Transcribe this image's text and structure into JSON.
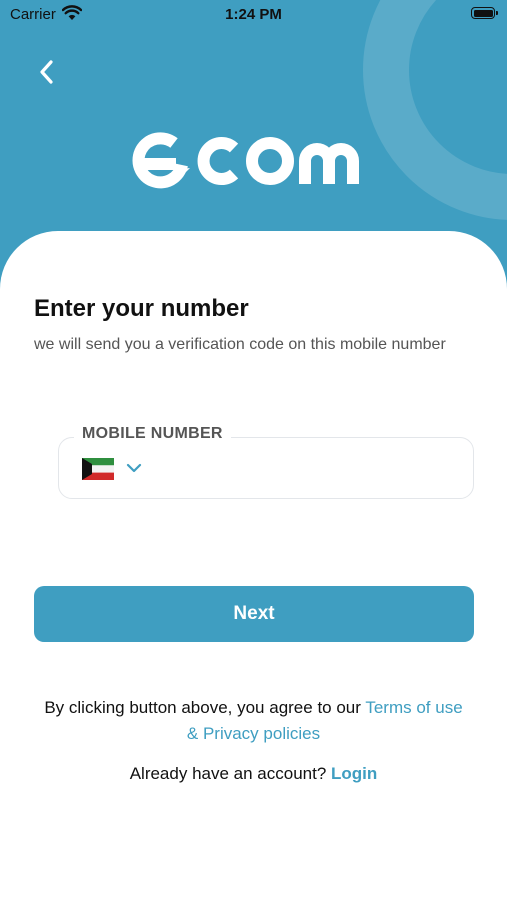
{
  "status_bar": {
    "carrier": "Carrier",
    "time": "1:24 PM"
  },
  "header": {
    "back_icon": "chevron-left-icon",
    "logo_text": "ecom",
    "background_color": "#3f9ec1"
  },
  "form": {
    "title": "Enter your number",
    "subtitle": "we will send you a verification code on this mobile number",
    "field_label": "MOBILE NUMBER",
    "country_flag": "kuwait-flag",
    "country_dropdown_icon": "chevron-down-icon",
    "phone_value": "",
    "next_label": "Next"
  },
  "footer": {
    "agreement_prefix": "By clicking button above, you agree to our",
    "terms_link": "Terms of use",
    "privacy_link": "& Privacy policies",
    "login_prompt": "Already have an account?",
    "login_link": "Login"
  },
  "colors": {
    "accent": "#3f9ec1",
    "text": "#111111",
    "muted_text": "#555555"
  }
}
